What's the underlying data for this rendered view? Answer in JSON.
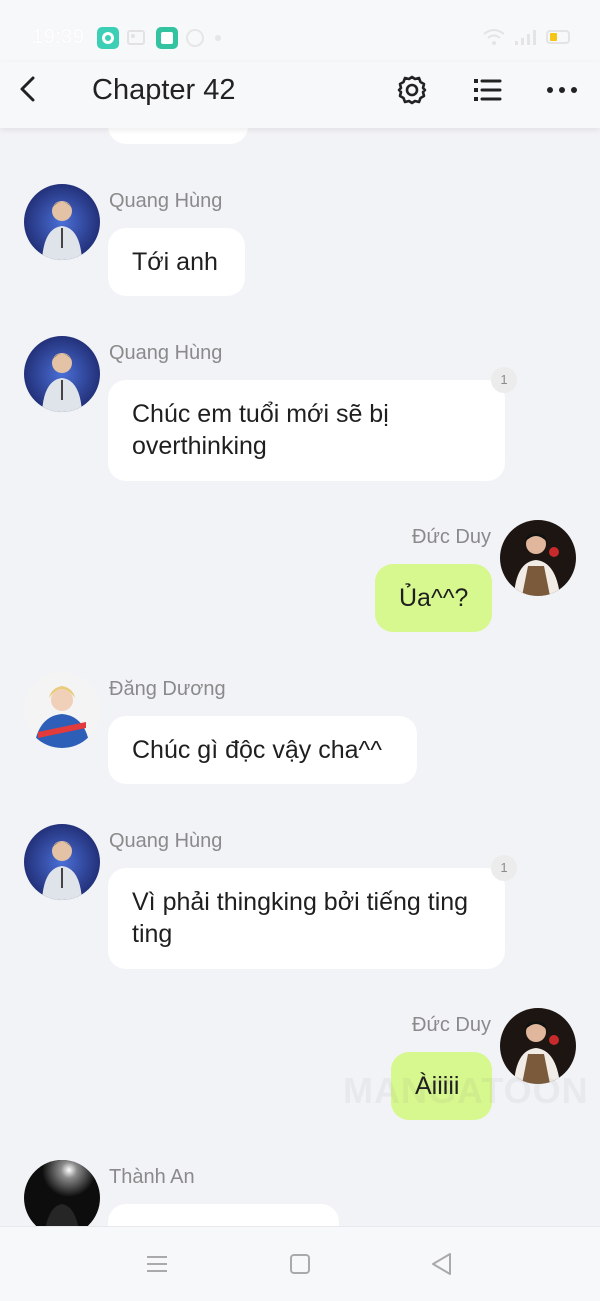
{
  "status_bar": {
    "time": "19:39",
    "icons": [
      "chat-app-icon",
      "image-icon",
      "notes-app-icon",
      "messenger-icon",
      "dot-icon",
      "wifi-icon",
      "signal-icon",
      "battery-icon"
    ]
  },
  "header": {
    "title": "Chapter 42",
    "icons": [
      "back-arrow-icon",
      "settings-gear-icon",
      "chapter-list-icon",
      "more-icon"
    ]
  },
  "messages": [
    {
      "sender": "Quang Hùng",
      "text": "Tới anh",
      "side": "left",
      "avatar": "quang-hung-avatar"
    },
    {
      "sender": "Quang Hùng",
      "text": "Chúc em tuổi mới sẽ bị overthinking",
      "side": "left",
      "avatar": "quang-hung-avatar",
      "read_count": "1"
    },
    {
      "sender": "Đức Duy",
      "text": "Ủa^^?",
      "side": "right",
      "avatar": "duc-duy-avatar"
    },
    {
      "sender": "Đăng Dương",
      "text": "Chúc gì độc vậy cha^^",
      "side": "left",
      "avatar": "dang-duong-avatar"
    },
    {
      "sender": "Quang Hùng",
      "text": "Vì phải thingking bởi tiếng ting ting",
      "side": "left",
      "avatar": "quang-hung-avatar",
      "read_count": "1"
    },
    {
      "sender": "Đức Duy",
      "text": "Àiiiii",
      "side": "right",
      "avatar": "duc-duy-avatar"
    },
    {
      "sender": "Thành An",
      "text": "",
      "side": "left",
      "avatar": "thanh-an-avatar"
    }
  ],
  "watermark": "MANGATOON",
  "nav": {
    "icons": [
      "menu-icon",
      "home-square-icon",
      "back-triangle-icon"
    ]
  },
  "colors": {
    "background": "#f2f3f7",
    "bubble_left": "#ffffff",
    "bubble_right": "#d7f78f",
    "sender_text": "#8a8a8a"
  }
}
